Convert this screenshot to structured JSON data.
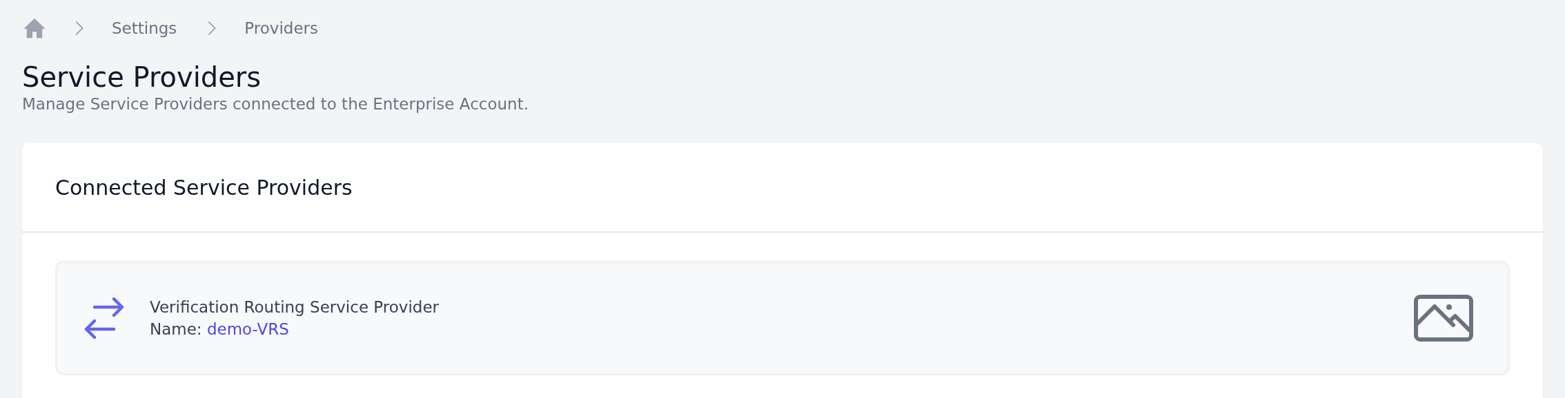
{
  "breadcrumb": [
    {
      "label": "Settings"
    },
    {
      "label": "Providers"
    }
  ],
  "page": {
    "title": "Service Providers",
    "subtitle": "Manage Service Providers connected to the Enterprise Account."
  },
  "card": {
    "title": "Connected Service Providers",
    "providers": [
      {
        "type": "Verification Routing Service Provider",
        "name_label": "Name:",
        "name": "demo-VRS"
      }
    ]
  }
}
